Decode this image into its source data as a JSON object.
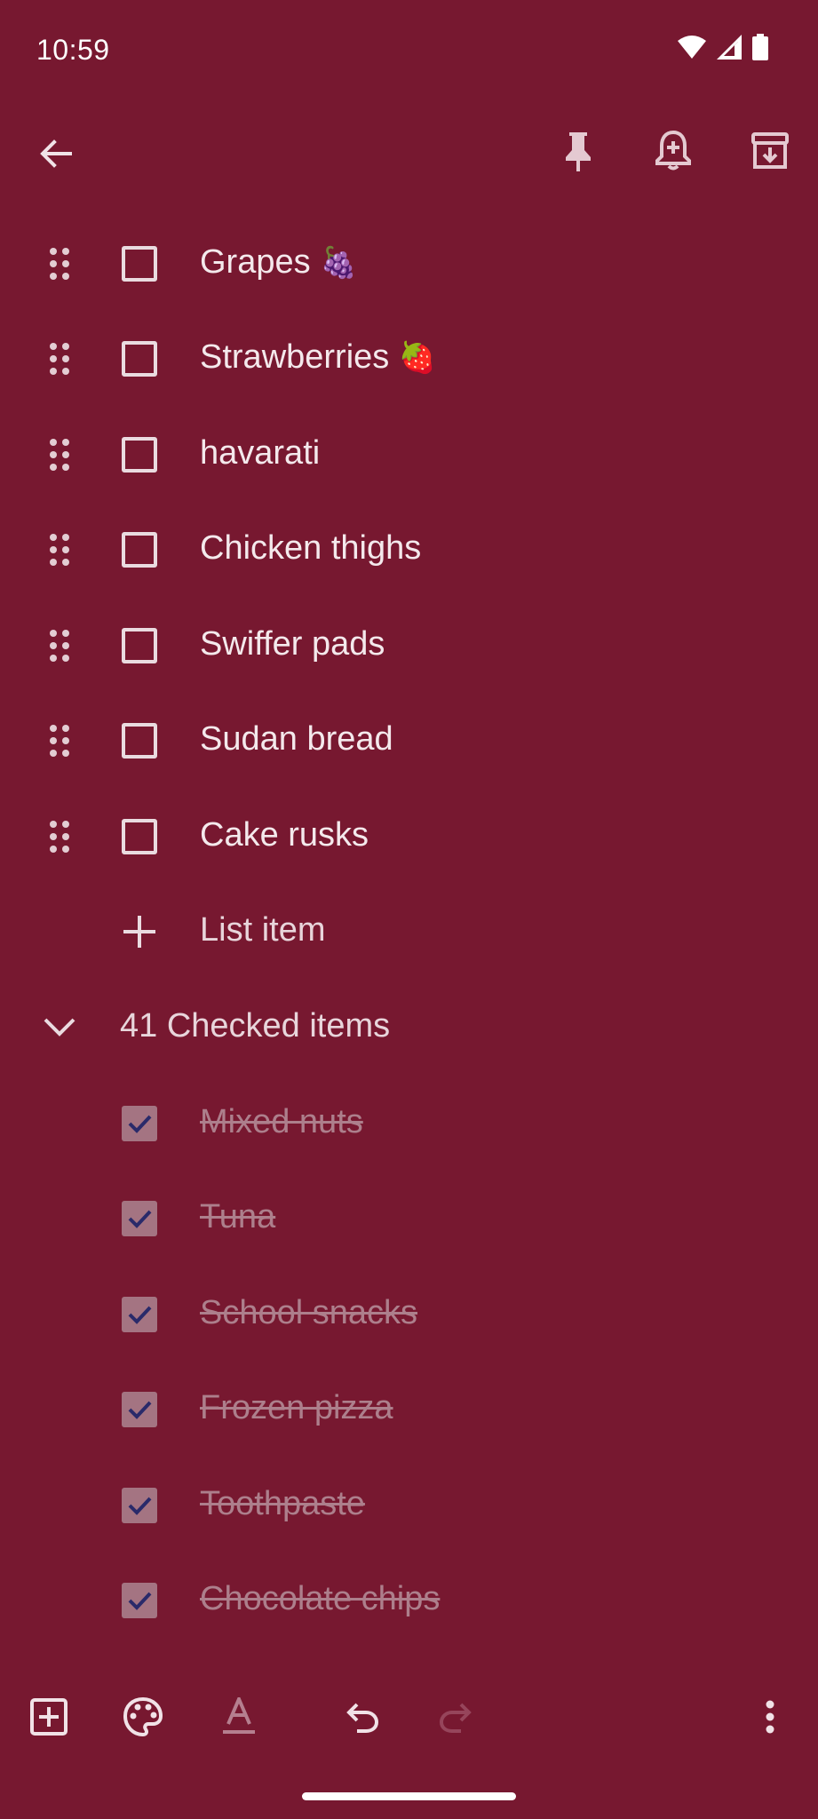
{
  "status": {
    "time": "10:59"
  },
  "open_items": [
    {
      "label": "Grapes",
      "emoji": "🍇"
    },
    {
      "label": "Strawberries",
      "emoji": "🍓"
    },
    {
      "label": "havarati",
      "emoji": ""
    },
    {
      "label": "Chicken thighs",
      "emoji": ""
    },
    {
      "label": "Swiffer pads",
      "emoji": ""
    },
    {
      "label": "Sudan bread",
      "emoji": ""
    },
    {
      "label": "Cake rusks",
      "emoji": ""
    }
  ],
  "add_item": {
    "label": "List item"
  },
  "checked_section": {
    "label": "41 Checked items"
  },
  "checked_items": [
    {
      "label": "Mixed nuts"
    },
    {
      "label": "Tuna"
    },
    {
      "label": "School snacks"
    },
    {
      "label": "Frozen pizza "
    },
    {
      "label": "Toothpaste"
    },
    {
      "label": "Chocolate chips "
    }
  ],
  "colors": {
    "background": "#771830",
    "checkbox_checked_fill": "#a47482",
    "checkmark": "#2a2a6a",
    "text_primary": "#f4e9ec",
    "text_checked": "#ad7f8c"
  },
  "icons": {
    "back": "arrow-left-icon",
    "pin": "pin-icon",
    "reminder": "bell-plus-icon",
    "archive": "archive-icon",
    "add_box": "add-box-icon",
    "palette": "palette-icon",
    "text_format": "text-format-icon",
    "undo": "undo-icon",
    "redo": "redo-icon",
    "more": "more-vert-icon"
  }
}
